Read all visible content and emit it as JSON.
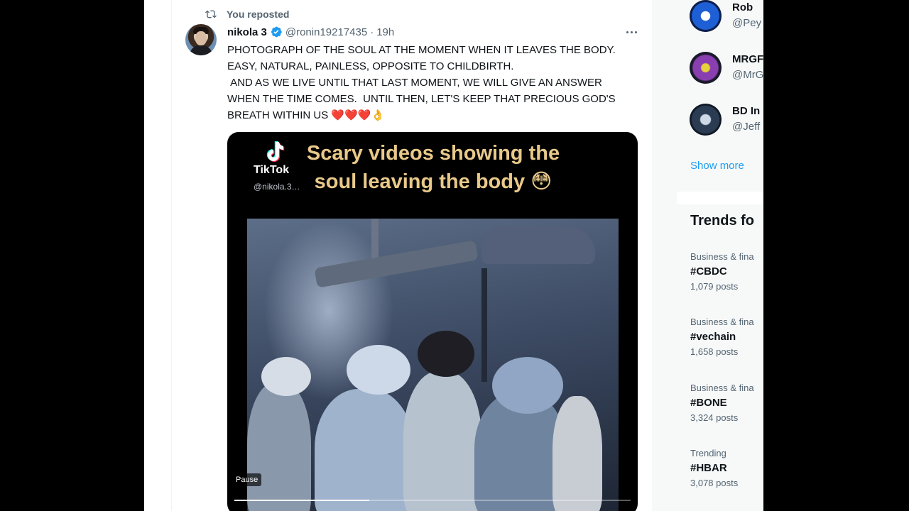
{
  "repost": {
    "label": "You reposted"
  },
  "tweet": {
    "author_name": "nikola 3",
    "author_handle": "@ronin19217435",
    "separator": "·",
    "time": "19h",
    "text_lines": [
      "PHOTOGRAPH OF THE SOUL AT THE MOMENT WHEN IT LEAVES THE BODY.  EASY, NATURAL, PAINLESS, OPPOSITE TO CHILDBIRTH.",
      " AND AS WE LIVE UNTIL THAT LAST MOMENT, WE WILL GIVE AN ANSWER WHEN THE TIME COMES.  UNTIL THEN, LET'S KEEP THAT PRECIOUS GOD'S BREATH WITHIN US"
    ],
    "emojis": {
      "hearts": "❤️❤️❤️",
      "ok": "👌"
    }
  },
  "video": {
    "tiktok_word": "TikTok",
    "tiktok_user": "@nikola.3…",
    "caption_line1": "Scary videos showing the",
    "caption_line2": "soul leaving the body 😳",
    "pause_label": "Pause",
    "progress_fraction": 0.34
  },
  "who_to_follow": [
    {
      "name": "Rob",
      "handle": "@Pey",
      "color": "#1f5fd6"
    },
    {
      "name": "MRGF",
      "handle": "@MrG",
      "color": "#5a2a7a"
    },
    {
      "name": "BD In",
      "handle": "@Jeff",
      "color": "#2a3b52"
    }
  ],
  "show_more": "Show more",
  "trends": {
    "title": "Trends fo",
    "items": [
      {
        "category": "Business & fina",
        "topic": "#CBDC",
        "posts": "1,079 posts"
      },
      {
        "category": "Business & fina",
        "topic": "#vechain",
        "posts": "1,658 posts"
      },
      {
        "category": "Business & fina",
        "topic": "#BONE",
        "posts": "3,324 posts"
      },
      {
        "category": "Trending",
        "topic": "#HBAR",
        "posts": "3,078 posts"
      }
    ]
  }
}
